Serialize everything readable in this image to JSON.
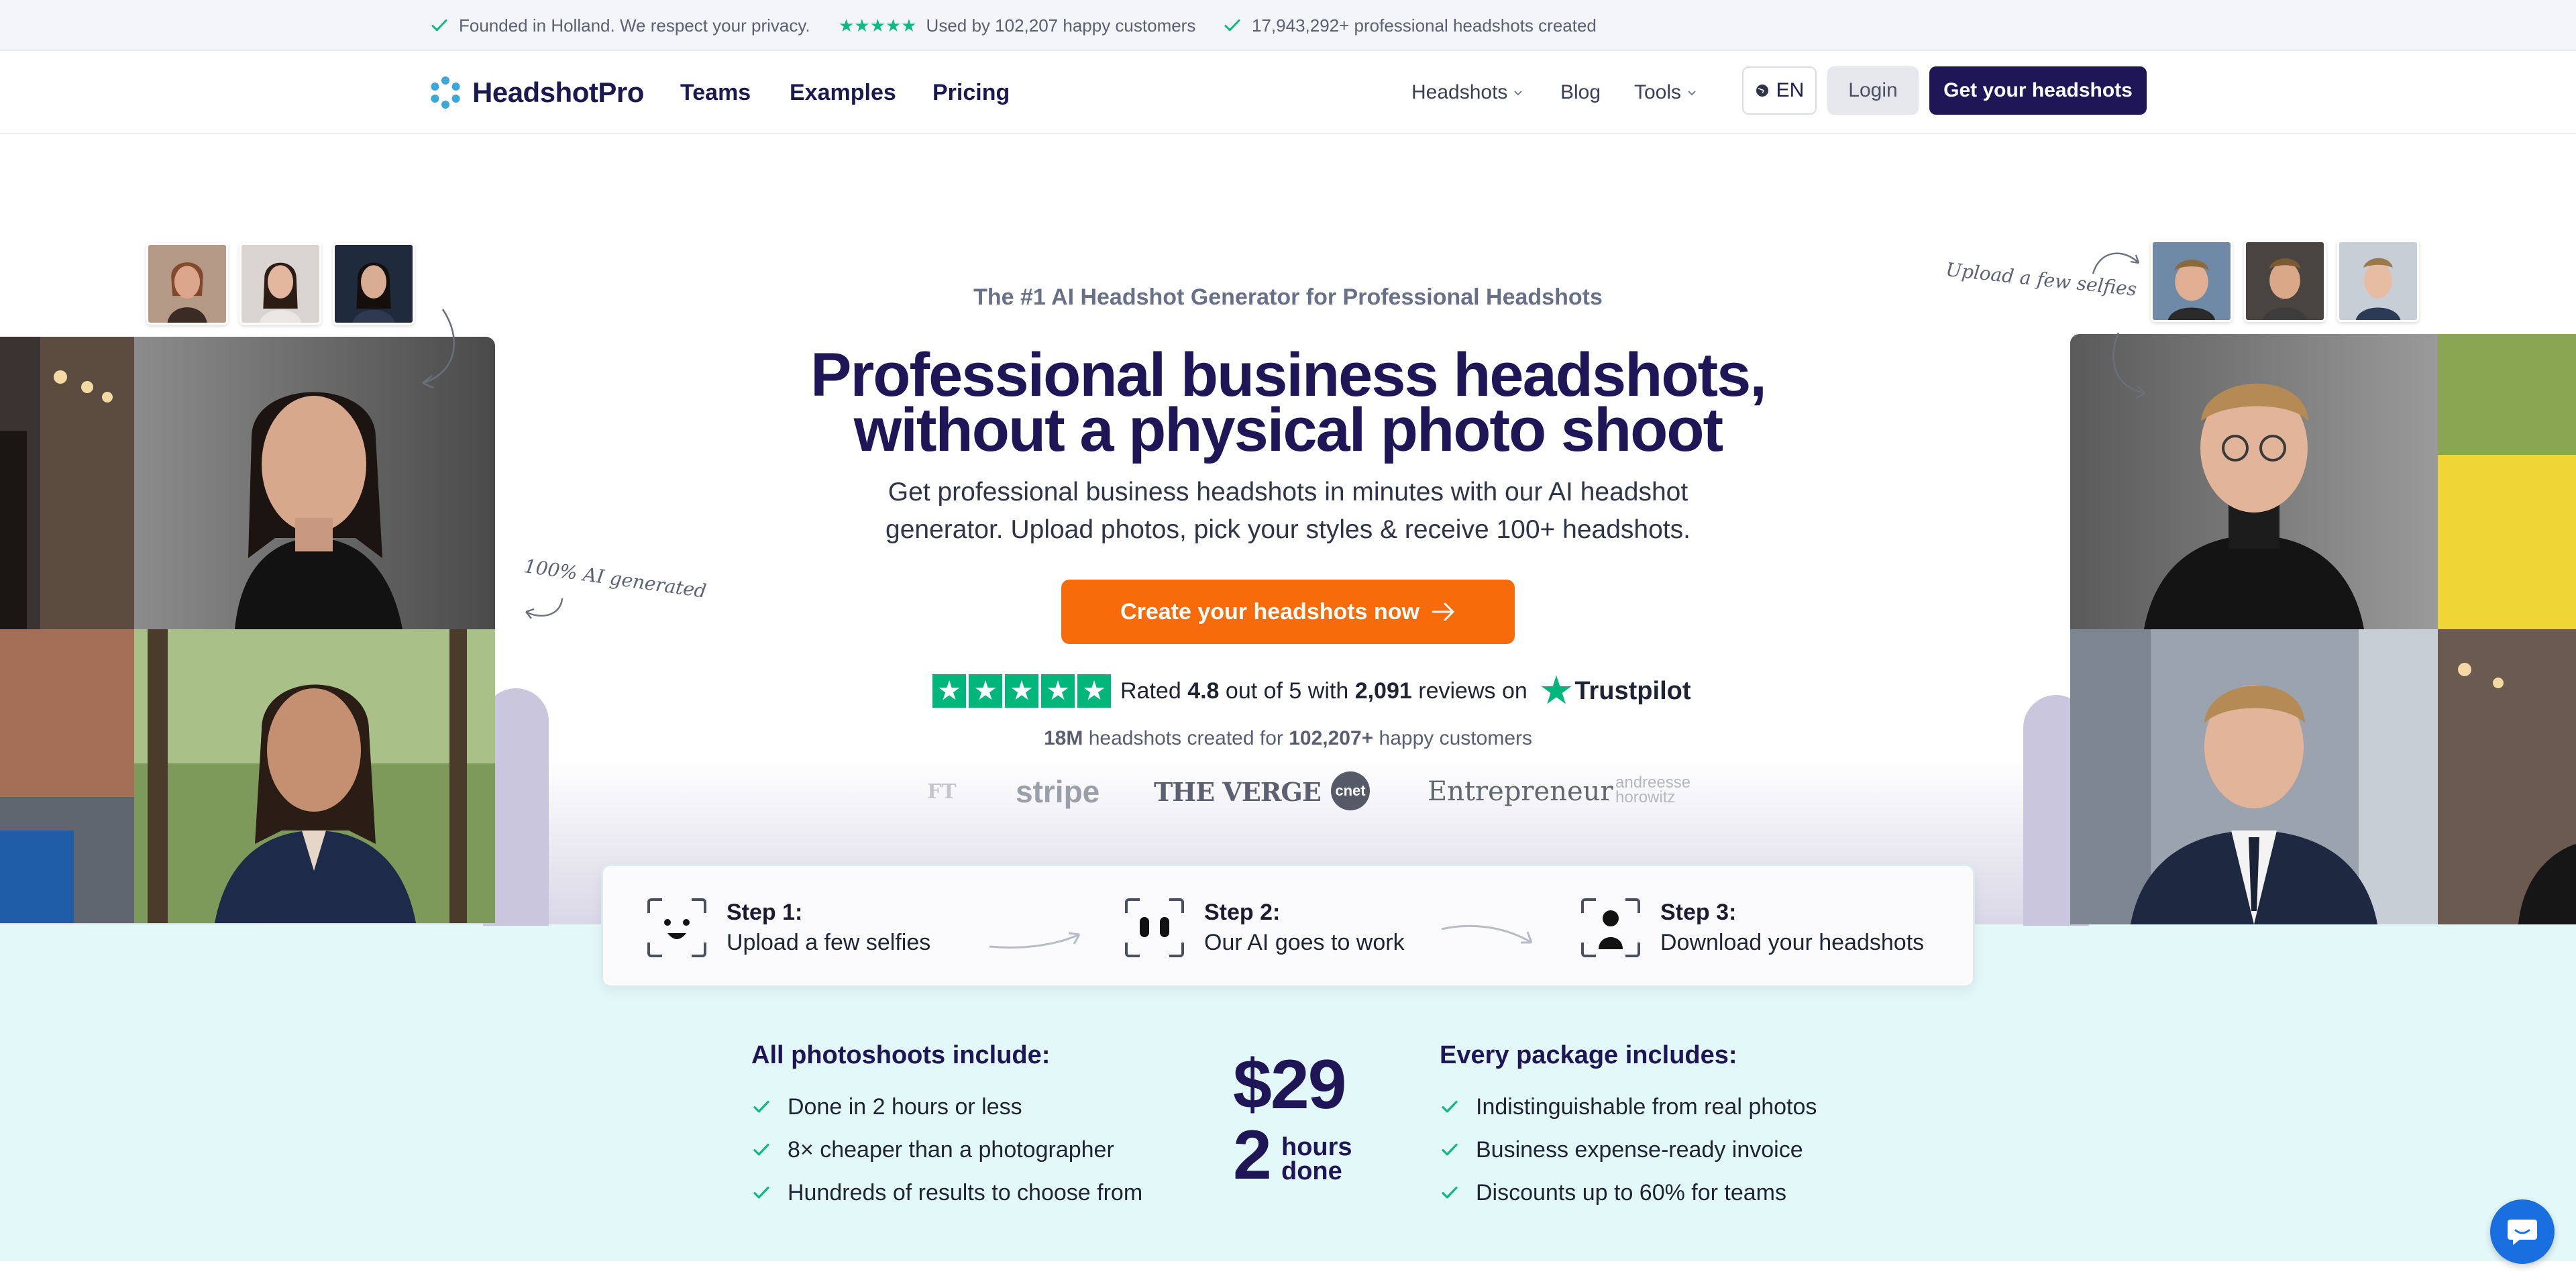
{
  "topbar": {
    "items": [
      {
        "text": "Founded in Holland. We respect your privacy."
      },
      {
        "text": "Used by 102,207 happy customers",
        "stars": "★★★★★"
      },
      {
        "text": "17,943,292+ professional headshots created"
      }
    ]
  },
  "nav": {
    "logo": "HeadshotPro",
    "main": [
      "Teams",
      "Examples",
      "Pricing"
    ],
    "secondary": [
      "Headshots",
      "Blog",
      "Tools"
    ],
    "lang": "EN",
    "login": "Login",
    "cta": "Get your headshots"
  },
  "hero": {
    "eyebrow": "The #1 AI Headshot Generator for Professional Headshots",
    "headline_line1": "Professional business headshots,",
    "headline_line2": "without a physical photo shoot",
    "subhead_line1": "Get professional business headshots in minutes with our AI headshot",
    "subhead_line2": "generator. Upload photos, pick your styles & receive 100+ headshots.",
    "cta": "Create your headshots now",
    "note_left": "100% AI generated",
    "note_right": "Upload a few selfies",
    "rating": {
      "rated": "Rated",
      "score": "4.8",
      "outof": "out of 5 with",
      "count": "2,091",
      "reviews_on": "reviews on",
      "brand": "Trustpilot"
    },
    "made": {
      "count": "18M",
      "mid": "headshots created for",
      "customers": "102,207+",
      "end": "happy customers"
    },
    "press": [
      "FT",
      "stripe",
      "THE VERGE",
      "cnet",
      "Entrepreneur",
      "andreessen horowitz"
    ]
  },
  "steps": [
    {
      "title": "Step 1:",
      "desc": "Upload a few selfies"
    },
    {
      "title": "Step 2:",
      "desc": "Our AI goes to work"
    },
    {
      "title": "Step 3:",
      "desc": "Download your headshots"
    }
  ],
  "includes": {
    "left_title": "All photoshoots include:",
    "left_items": [
      "Done in 2 hours or less",
      "8× cheaper than a photographer",
      "Hundreds of results to choose from"
    ],
    "price": "$29",
    "hours_num": "2",
    "hours_word1": "hours",
    "hours_word2": "done",
    "right_title": "Every package includes:",
    "right_items": [
      "Indistinguishable from real photos",
      "Business expense-ready invoice",
      "Discounts up to 60% for teams"
    ]
  },
  "colors": {
    "brand_navy": "#1e1657",
    "cta_orange": "#f76b0a",
    "trust_green": "#00b67a",
    "mint_bg": "#e3f8f8"
  },
  "icons": [
    "check-icon",
    "star-icon",
    "globe-icon",
    "chevron-down-icon",
    "arrow-right-icon",
    "selfie-icon",
    "ai-face-icon",
    "download-person-icon",
    "chat-icon"
  ]
}
